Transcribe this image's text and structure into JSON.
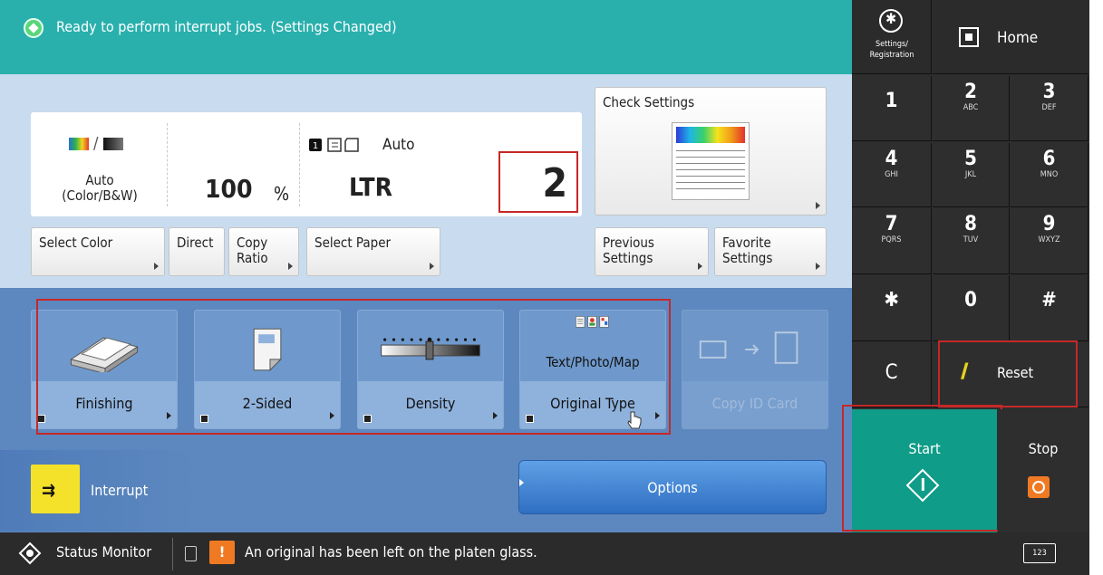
{
  "top_status": {
    "text": "Ready to perform interrupt jobs. (Settings Changed)"
  },
  "info": {
    "color_mode": {
      "line1": "Auto",
      "line2": "(Color/B&W)"
    },
    "copy_ratio": {
      "value": "100",
      "unit": "%"
    },
    "paper": {
      "source": "Auto",
      "size": "LTR"
    },
    "copies": "2"
  },
  "buttons": {
    "check_settings": "Check Settings",
    "select_color": "Select Color",
    "direct": "Direct",
    "copy_ratio_line1": "Copy",
    "copy_ratio_line2": "Ratio",
    "select_paper": "Select Paper",
    "previous_line1": "Previous",
    "previous_line2": "Settings",
    "favorite_line1": "Favorite",
    "favorite_line2": "Settings"
  },
  "functions": {
    "finishing": "Finishing",
    "two_sided": "2-Sided",
    "density": "Density",
    "original_type_value": "Text/Photo/Map",
    "original_type": "Original Type",
    "copy_id_card": "Copy ID Card"
  },
  "interrupt": {
    "label": "Interrupt"
  },
  "options": {
    "label": "Options"
  },
  "bottom_bar": {
    "status_monitor": "Status Monitor",
    "message": "An original has been left on the platen glass."
  },
  "keypad": {
    "settings_line1": "Settings/",
    "settings_line2": "Registration",
    "home": "Home",
    "keys": [
      {
        "d": "1",
        "s": ""
      },
      {
        "d": "2",
        "s": "ABC"
      },
      {
        "d": "3",
        "s": "DEF"
      },
      {
        "d": "4",
        "s": "GHI"
      },
      {
        "d": "5",
        "s": "JKL"
      },
      {
        "d": "6",
        "s": "MNO"
      },
      {
        "d": "7",
        "s": "PQRS"
      },
      {
        "d": "8",
        "s": "TUV"
      },
      {
        "d": "9",
        "s": "WXYZ"
      },
      {
        "d": "✱",
        "s": ""
      },
      {
        "d": "0",
        "s": ""
      },
      {
        "d": "#",
        "s": ""
      }
    ],
    "clear": "C",
    "reset": "Reset",
    "start": "Start",
    "stop": "Stop",
    "numeric_keys": "123"
  },
  "colors": {
    "teal": "#29b0ad",
    "blue_band": "#5d88bf",
    "highlight": "#c62828",
    "start": "#0f9c88"
  }
}
